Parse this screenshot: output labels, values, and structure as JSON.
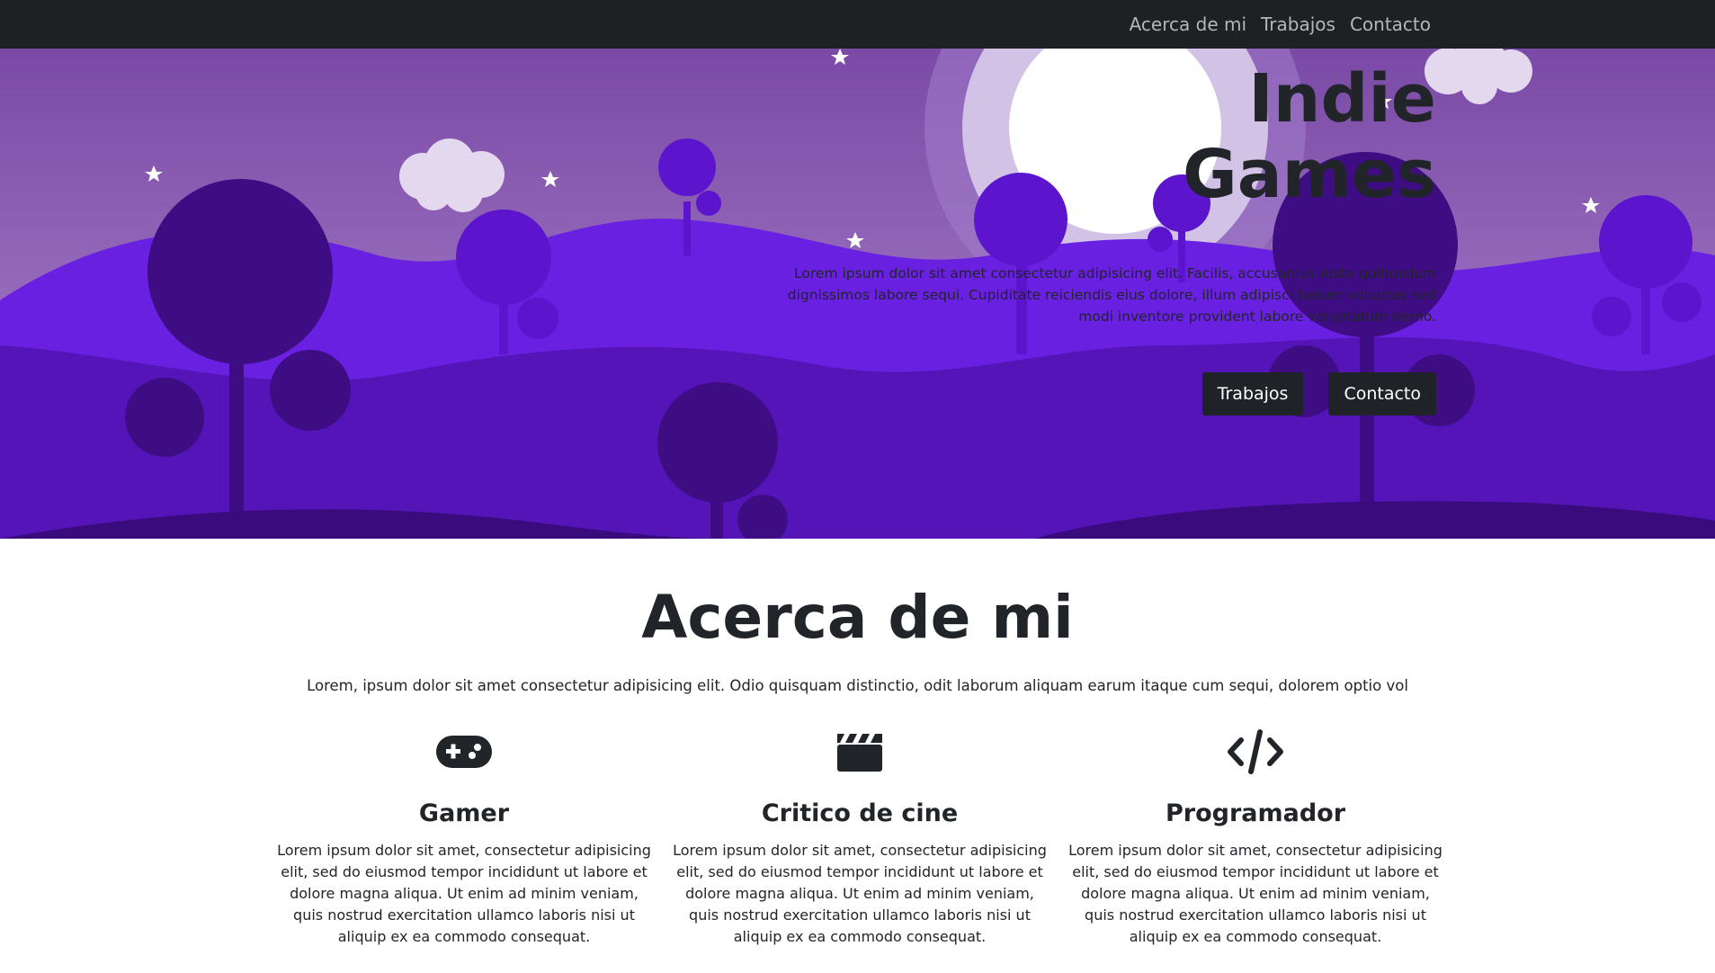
{
  "nav": {
    "links": [
      "Acerca de mi",
      "Trabajos",
      "Contacto"
    ]
  },
  "hero": {
    "title_line1": "Indie",
    "title_line2": "Games",
    "text": "Lorem ipsum dolor sit amet consectetur adipisicing elit. Facilis, accusamus iusto quibusdam dignissimos labore sequi. Cupiditate reiciendis eius dolore, illum adipisci harum voluptas sed modi inventore provident labore voluptatum nemo.",
    "buttons": [
      "Trabajos",
      "Contacto"
    ]
  },
  "about": {
    "title": "Acerca de mi",
    "text": "Lorem, ipsum dolor sit amet consectetur adipisicing elit. Odio quisquam distinctio, odit laborum aliquam earum itaque cum sequi, dolorem optio vol",
    "columns": [
      {
        "icon": "gamepad-icon",
        "title": "Gamer",
        "text": "Lorem ipsum dolor sit amet, consectetur adipisicing elit, sed do eiusmod tempor incididunt ut labore et dolore magna aliqua. Ut enim ad minim veniam, quis nostrud exercitation ullamco laboris nisi ut aliquip ex ea commodo consequat."
      },
      {
        "icon": "clapperboard-icon",
        "title": "Critico de cine",
        "text": "Lorem ipsum dolor sit amet, consectetur adipisicing elit, sed do eiusmod tempor incididunt ut labore et dolore magna aliqua. Ut enim ad minim veniam, quis nostrud exercitation ullamco laboris nisi ut aliquip ex ea commodo consequat."
      },
      {
        "icon": "code-icon",
        "title": "Programador",
        "text": "Lorem ipsum dolor sit amet, consectetur adipisicing elit, sed do eiusmod tempor incididunt ut labore et dolore magna aliqua. Ut enim ad minim veniam, quis nostrud exercitation ullamco laboris nisi ut aliquip ex ea commodo consequat."
      }
    ]
  }
}
